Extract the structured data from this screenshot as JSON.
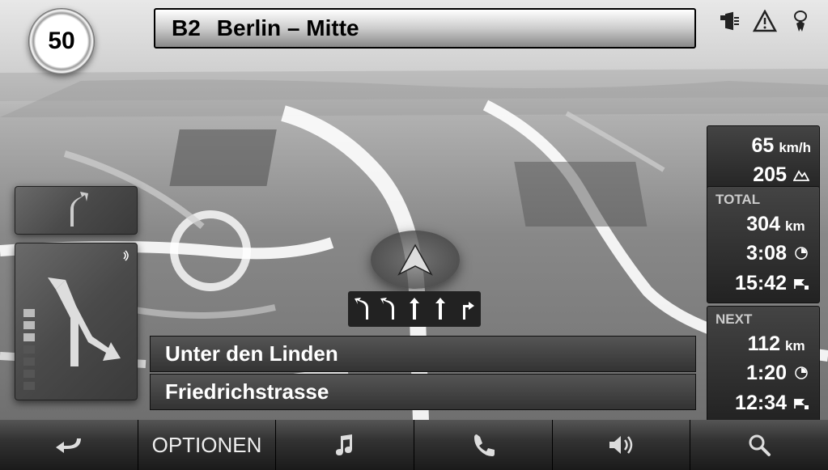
{
  "speed_limit": "50",
  "road": {
    "id": "B2",
    "name": "Berlin – Mitte"
  },
  "status_icons": {
    "tmc": "tmc-icon",
    "warning": "warning-icon",
    "gps": "gps-icon"
  },
  "current_speed": {
    "value": "65",
    "unit": "km/h"
  },
  "altitude": {
    "value": "205",
    "icon": "mountain-icon"
  },
  "total": {
    "label": "TOTAL",
    "distance": {
      "value": "304",
      "unit": "km"
    },
    "duration": "3:08",
    "arrival": "15:42"
  },
  "next": {
    "label": "NEXT",
    "distance": {
      "value": "112",
      "unit": "km"
    },
    "duration": "1:20",
    "arrival": "12:34"
  },
  "streets": {
    "next": "Unter den Linden",
    "current": "Friedrichstrasse"
  },
  "lanes": [
    "left-curve",
    "left-curve",
    "straight",
    "straight",
    "right"
  ],
  "toolbar": {
    "back": "back-icon",
    "options": "OPTIONEN",
    "music": "music-icon",
    "phone": "phone-icon",
    "volume": "volume-icon",
    "search": "search-icon"
  }
}
